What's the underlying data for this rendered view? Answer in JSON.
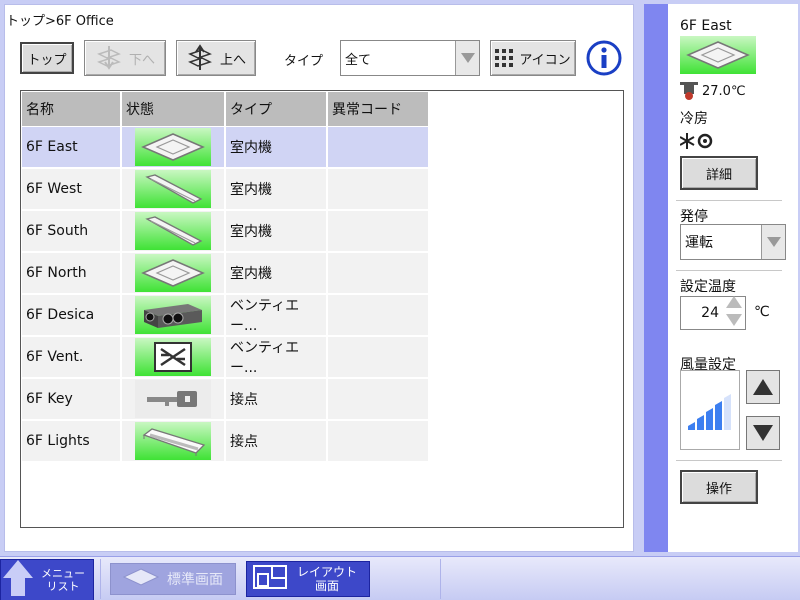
{
  "breadcrumb": "トップ>6F Office",
  "toolbar": {
    "top_label": "トップ",
    "down_label": "下へ",
    "up_label": "上へ",
    "type_label": "タイプ",
    "type_value": "全て",
    "icon_label": "アイコン"
  },
  "table": {
    "headers": [
      "名称",
      "状態",
      "タイプ",
      "異常コード"
    ],
    "rows": [
      {
        "name": "6F East",
        "type": "室内機",
        "error": "",
        "icon": "ceiling-cassette-icon",
        "selected": true
      },
      {
        "name": "6F West",
        "type": "室内機",
        "error": "",
        "icon": "wall-slim-unit-icon",
        "selected": false
      },
      {
        "name": "6F South",
        "type": "室内機",
        "error": "",
        "icon": "wall-slim-unit-icon",
        "selected": false
      },
      {
        "name": "6F North",
        "type": "室内機",
        "error": "",
        "icon": "ceiling-cassette-icon",
        "selected": false
      },
      {
        "name": "6F Desica",
        "type": "ベンティエー...",
        "error": "",
        "icon": "desiccant-unit-icon",
        "selected": false
      },
      {
        "name": "6F Vent.",
        "type": "ベンティエー...",
        "error": "",
        "icon": "ventilation-icon",
        "selected": false
      },
      {
        "name": "6F Key",
        "type": "接点",
        "error": "",
        "icon": "key-icon",
        "selected": false
      },
      {
        "name": "6F Lights",
        "type": "接点",
        "error": "",
        "icon": "light-fixture-icon",
        "selected": false
      }
    ]
  },
  "right_panel": {
    "unit_name": "6F East",
    "room_temp": "27.0℃",
    "mode": "冷房",
    "detail_label": "詳細",
    "onoff_label": "発停",
    "onoff_value": "運転",
    "set_temp_label": "設定温度",
    "set_temp_value": "24",
    "temp_unit": "℃",
    "fan_label": "風量設定",
    "fan_level": 0.8,
    "operate_label": "操作"
  },
  "bottom_bar": {
    "menu_line1": "メニュー",
    "menu_line2": "リスト",
    "standard_label": "標準画面",
    "layout_line1": "レイアウト",
    "layout_line2": "画面"
  },
  "colors": {
    "status_green": "#3fe235",
    "selected_row": "#d0d4f4",
    "accent_blue": "#3d48c9",
    "panel_purple": "#7f86f0"
  }
}
